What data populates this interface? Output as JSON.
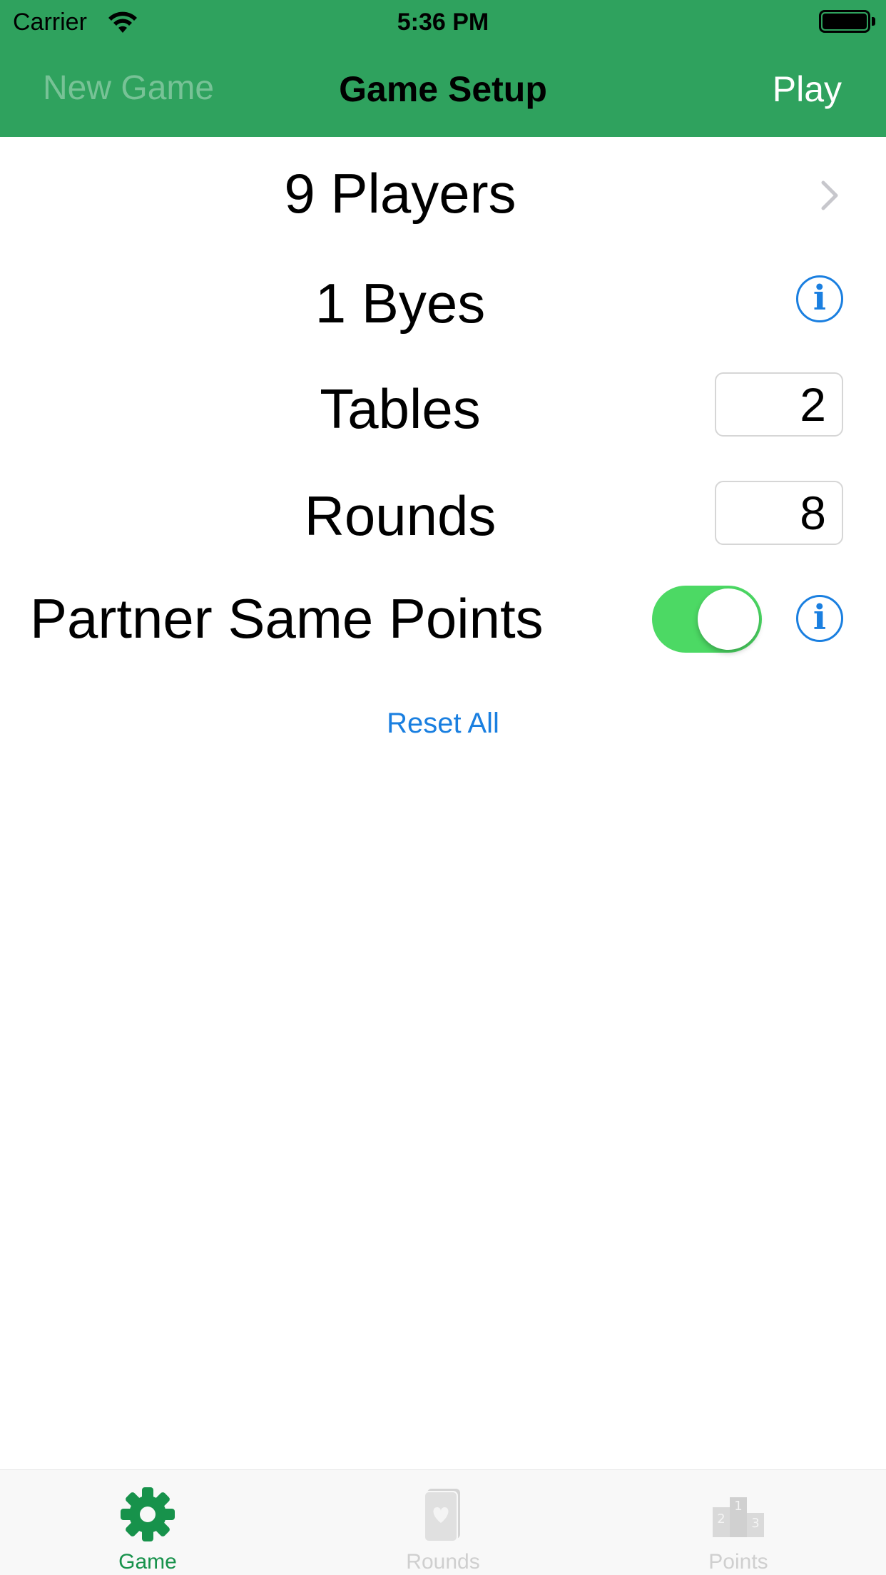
{
  "status_bar": {
    "carrier": "Carrier",
    "time": "5:36 PM"
  },
  "nav": {
    "left_button": "New Game",
    "title": "Game Setup",
    "right_button": "Play"
  },
  "settings": {
    "players_label": "9 Players",
    "byes_label": "1 Byes",
    "tables_label": "Tables",
    "tables_value": "2",
    "rounds_label": "Rounds",
    "rounds_value": "8",
    "partner_label": "Partner Same Points",
    "partner_enabled": true,
    "info_glyph": "i"
  },
  "reset_label": "Reset All",
  "tabs": [
    {
      "label": "Game",
      "icon": "gear-icon",
      "active": true
    },
    {
      "label": "Rounds",
      "icon": "card-icon",
      "active": false
    },
    {
      "label": "Points",
      "icon": "podium-icon",
      "active": false
    }
  ],
  "colors": {
    "header_green": "#2fa25e",
    "toggle_on": "#4cd964",
    "link_blue": "#1a7fe0",
    "tab_active": "#17924b",
    "tab_inactive": "#cfcfcf"
  }
}
